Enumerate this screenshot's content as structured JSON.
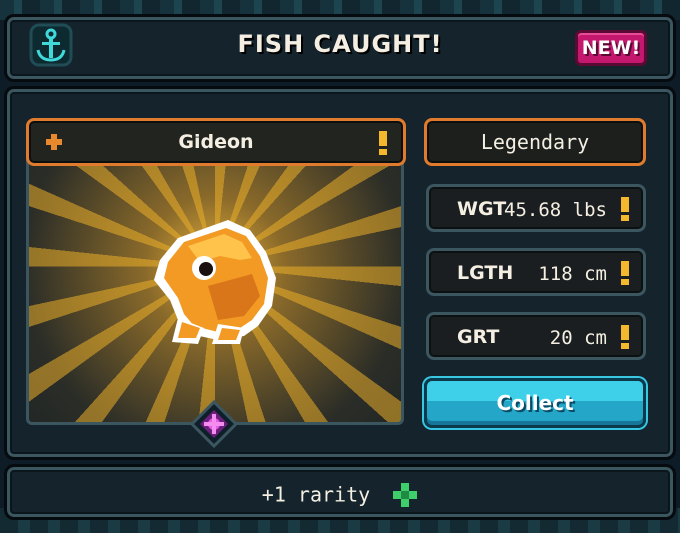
{
  "header": {
    "title": "FISH CAUGHT!",
    "badge": "NEW!",
    "badge_color": "#c4186e"
  },
  "fish": {
    "name": "Gideon",
    "rarity": "Legendary",
    "sprite_icon": "orange-fish-sprite",
    "stats": [
      {
        "label": "WGT",
        "value": "45.68 lbs"
      },
      {
        "label": "LGTH",
        "value": "118 cm"
      },
      {
        "label": "GRT",
        "value": "20 cm"
      }
    ]
  },
  "actions": {
    "collect_label": "Collect"
  },
  "footer": {
    "text": "+1 rarity",
    "icon": "green-clover-icon"
  },
  "colors": {
    "accent_orange": "#e07a2c",
    "exclaim_yellow": "#f4b82c",
    "collect_cyan": "#3ecfe9"
  }
}
